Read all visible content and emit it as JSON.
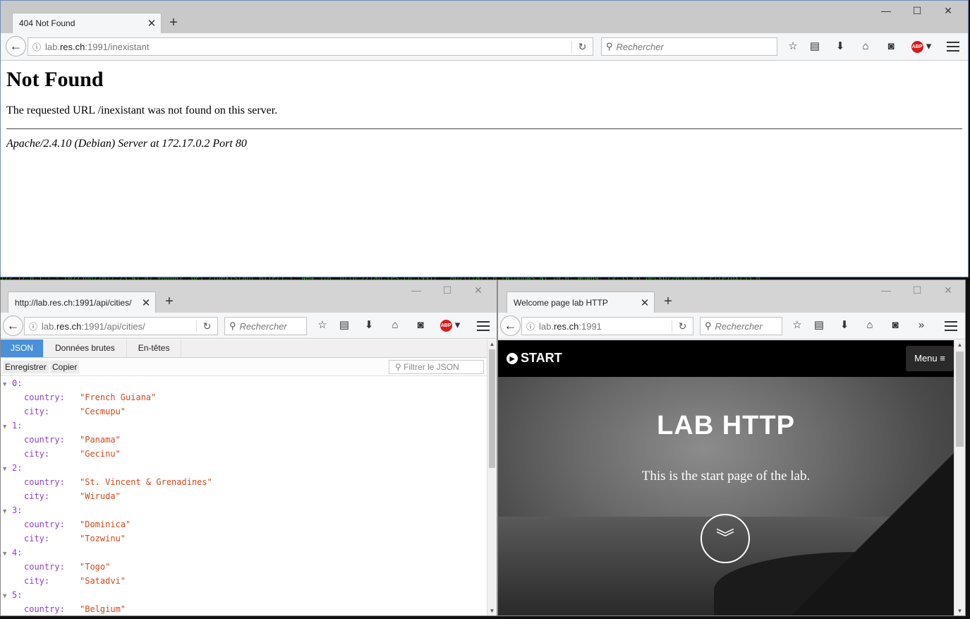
{
  "terminal_text": "172.17.0.1 - - [07/Jun/2017:23:41:07 +0000] \"GET /inexistant HTTP/1.1\" 404 518 \"http://lab.res.ch:1991/\" \"Mozilla/5.0 (Windows NT 10.0; WOW64; rv:53.0) Gecko/20100101 Firefox/53.0\"",
  "win1": {
    "tab_title": "404 Not Found",
    "url_host_pre": "lab.",
    "url_host": "res.ch",
    "url_rest": ":1991/inexistant",
    "search_placeholder": "Rechercher",
    "heading": "Not Found",
    "message": "The requested URL /inexistant was not found on this server.",
    "address": "Apache/2.4.10 (Debian) Server at 172.17.0.2 Port 80"
  },
  "win2": {
    "tab_title": "http://lab.res.ch:1991/api/cities/",
    "url_host_pre": "lab.",
    "url_host": "res.ch",
    "url_rest": ":1991/api/cities/",
    "search_placeholder": "Rechercher",
    "tabs": [
      "JSON",
      "Données brutes",
      "En-têtes"
    ],
    "save_label": "Enregistrer",
    "copy_label": "Copier",
    "filter_placeholder": "Filtrer le JSON",
    "key_country": "country:",
    "key_city": "city:",
    "records": [
      {
        "index": "0:",
        "country": "\"French Guiana\"",
        "city": "\"Cecmupu\""
      },
      {
        "index": "1:",
        "country": "\"Panama\"",
        "city": "\"Gecinu\""
      },
      {
        "index": "2:",
        "country": "\"St. Vincent & Grenadines\"",
        "city": "\"Wiruda\""
      },
      {
        "index": "3:",
        "country": "\"Dominica\"",
        "city": "\"Tozwinu\""
      },
      {
        "index": "4:",
        "country": "\"Togo\"",
        "city": "\"Satadvi\""
      },
      {
        "index": "5:",
        "country": "\"Belgium\"",
        "city": ""
      }
    ]
  },
  "win3": {
    "tab_title": "Welcome page lab HTTP",
    "url_host_pre": "lab.",
    "url_host": "res.ch",
    "url_rest": ":1991",
    "search_placeholder": "Rechercher",
    "brand": "START",
    "menu_label": "Menu",
    "hero_title": "LAB HTTP",
    "hero_subtitle": "This is the start page of the lab."
  },
  "icons": {
    "back": "arrow-left",
    "info": "info",
    "reload": "reload",
    "search": "magnifier",
    "bookmark": "star",
    "reading_list": "clipboard",
    "download": "arrow-down",
    "home": "house",
    "pocket": "pocket",
    "adblock": "ABP",
    "overflow": "chevrons-right",
    "menu": "hamburger"
  }
}
